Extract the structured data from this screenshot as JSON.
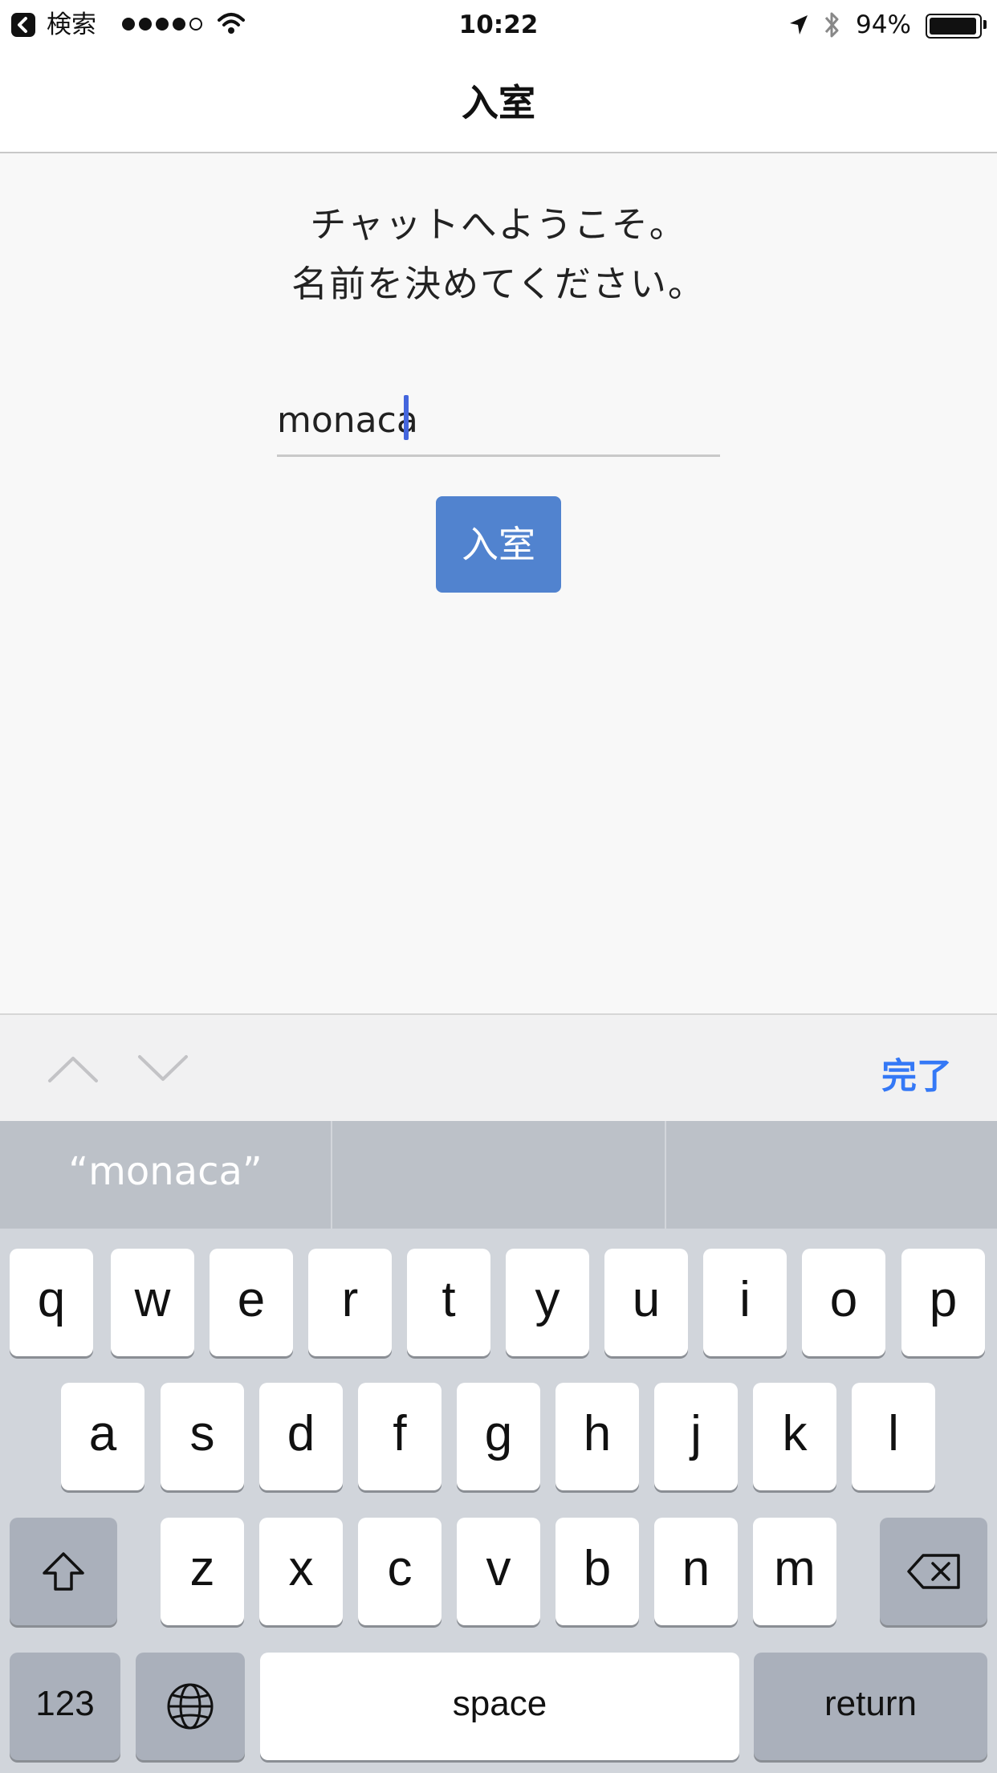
{
  "status_bar": {
    "back_label": "検索",
    "time": "10:22",
    "battery": "94%"
  },
  "nav": {
    "title": "入室"
  },
  "welcome": {
    "line1": "チャットへようこそ。",
    "line2": "名前を決めてください。"
  },
  "name_input": {
    "value": "monaca"
  },
  "enter_button": {
    "label": "入室"
  },
  "accessory": {
    "done_label": "完了"
  },
  "predictive": {
    "suggestions": [
      "“monaca”",
      "",
      ""
    ]
  },
  "keyboard": {
    "row1": [
      "q",
      "w",
      "e",
      "r",
      "t",
      "y",
      "u",
      "i",
      "o",
      "p"
    ],
    "row2": [
      "a",
      "s",
      "d",
      "f",
      "g",
      "h",
      "j",
      "k",
      "l"
    ],
    "row3": [
      "z",
      "x",
      "c",
      "v",
      "b",
      "n",
      "m"
    ],
    "numbers_label": "123",
    "space_label": "space",
    "return_label": "return"
  },
  "icons": [
    "back-icon",
    "signal-dots-icon",
    "wifi-icon",
    "location-arrow-icon",
    "bluetooth-icon",
    "battery-icon",
    "chevron-up-icon",
    "chevron-down-icon",
    "shift-icon",
    "delete-icon",
    "globe-icon"
  ]
}
